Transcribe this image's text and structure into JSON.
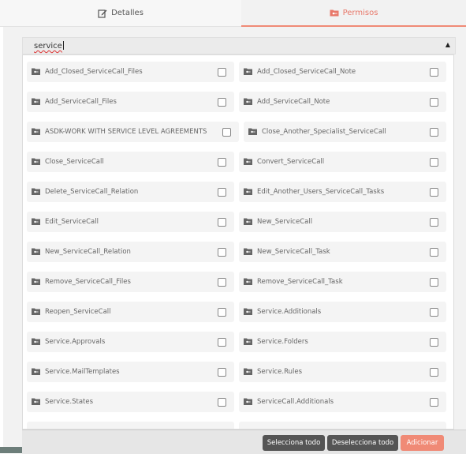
{
  "tabs": [
    {
      "label": "Detalles",
      "icon": "edit-icon",
      "active": false
    },
    {
      "label": "Permisos",
      "icon": "folder-key-icon",
      "active": true
    }
  ],
  "search": {
    "value": "service",
    "toggle_icon": "caret-up-icon"
  },
  "colors": {
    "accent": "#f08a76",
    "dark_button": "#555555",
    "panel": "#f2f2f2",
    "item_bg": "#f4f4f4"
  },
  "permissions": [
    {
      "left": "Add_Closed_ServiceCall_Files",
      "right": "Add_Closed_ServiceCall_Note"
    },
    {
      "left": "Add_ServiceCall_Files",
      "right": "Add_ServiceCall_Note"
    },
    {
      "left": "ASDK-WORK WITH SERVICE LEVEL AGREEMENTS",
      "right": "Close_Another_Specialist_ServiceCall"
    },
    {
      "left": "Close_ServiceCall",
      "right": "Convert_ServiceCall"
    },
    {
      "left": "Delete_ServiceCall_Relation",
      "right": "Edit_Another_Users_ServiceCall_Tasks"
    },
    {
      "left": "Edit_ServiceCall",
      "right": "New_ServiceCall"
    },
    {
      "left": "New_ServiceCall_Relation",
      "right": "New_ServiceCall_Task"
    },
    {
      "left": "Remove_ServiceCall_Files",
      "right": "Remove_ServiceCall_Task"
    },
    {
      "left": "Reopen_ServiceCall",
      "right": "Service.Additionals"
    },
    {
      "left": "Service.Approvals",
      "right": "Service.Folders"
    },
    {
      "left": "Service.MailTemplates",
      "right": "Service.Rules"
    },
    {
      "left": "Service.States",
      "right": "ServiceCall.Additionals"
    }
  ],
  "footer": {
    "select_all": "Selecciona todo",
    "deselect_all": "Deselecciona todo",
    "add": "Adicionar"
  }
}
